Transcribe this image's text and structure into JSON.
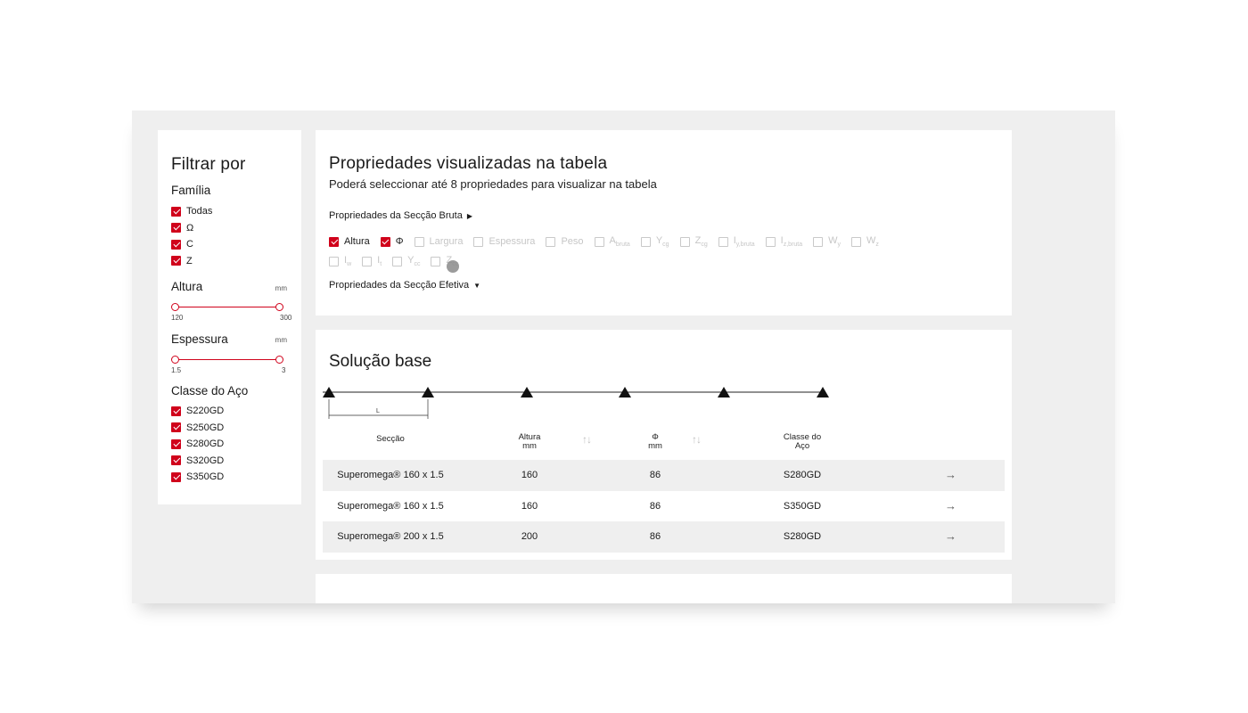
{
  "filter": {
    "title": "Filtrar por",
    "familia": {
      "label": "Família",
      "items": [
        {
          "label": "Todas",
          "checked": true
        },
        {
          "label": "Ω",
          "checked": true
        },
        {
          "label": "C",
          "checked": true
        },
        {
          "label": "Z",
          "checked": true
        }
      ]
    },
    "altura": {
      "label": "Altura",
      "unit": "mm",
      "min": "120",
      "max": "300",
      "range_low_fraction": 0,
      "range_high_fraction": 1
    },
    "espessura": {
      "label": "Espessura",
      "unit": "mm",
      "min": "1.5",
      "max": "3",
      "range_low_fraction": 0,
      "range_high_fraction": 1
    },
    "classe": {
      "label": "Classe do Aço",
      "items": [
        {
          "label": "S220GD",
          "checked": true
        },
        {
          "label": "S250GD",
          "checked": true
        },
        {
          "label": "S280GD",
          "checked": true
        },
        {
          "label": "S320GD",
          "checked": true
        },
        {
          "label": "S350GD",
          "checked": true
        }
      ]
    }
  },
  "props": {
    "title": "Propriedades visualizadas na tabela",
    "subtitle": "Poderá seleccionar até 8 propriedades para visualizar na tabela",
    "bruta_label": "Propriedades da Secção Bruta",
    "bruta_arrow": "▶",
    "efetiva_label": "Propriedades da Secção Efetiva",
    "efetiva_arrow": "▼",
    "row1": [
      {
        "label": "Altura",
        "sub": "",
        "checked": true
      },
      {
        "label": "Φ",
        "sub": "",
        "checked": true
      },
      {
        "label": "Largura",
        "sub": "",
        "checked": false
      },
      {
        "label": "Espessura",
        "sub": "",
        "checked": false
      },
      {
        "label": "Peso",
        "sub": "",
        "checked": false
      },
      {
        "label": "A",
        "sub": "bruta",
        "checked": false
      },
      {
        "label": "Y",
        "sub": "cg",
        "checked": false
      },
      {
        "label": "Z",
        "sub": "cg",
        "checked": false
      },
      {
        "label": "I",
        "sub": "y,bruta",
        "checked": false
      },
      {
        "label": "I",
        "sub": "z,bruta",
        "checked": false
      },
      {
        "label": "W",
        "sub": "y",
        "checked": false
      },
      {
        "label": "W",
        "sub": "z",
        "checked": false
      }
    ],
    "row2": [
      {
        "label": "I",
        "sub": "w",
        "checked": false
      },
      {
        "label": "I",
        "sub": "t",
        "checked": false
      },
      {
        "label": "Y",
        "sub": "cc",
        "checked": false
      },
      {
        "label": "Z",
        "sub": "cc",
        "checked": false
      }
    ]
  },
  "solution": {
    "title": "Solução base",
    "span_label": "L",
    "headers": {
      "seccao": "Secção",
      "altura": "Altura",
      "altura_unit": "mm",
      "phi": "Φ",
      "phi_unit": "mm",
      "classe_line1": "Classe do",
      "classe_line2": "Aço",
      "sort_icon": "↑↓"
    },
    "rows": [
      {
        "seccao": "Superomega® 160 x 1.5",
        "altura": "160",
        "phi": "86",
        "classe": "S280GD",
        "arrow": "→"
      },
      {
        "seccao": "Superomega® 160 x 1.5",
        "altura": "160",
        "phi": "86",
        "classe": "S350GD",
        "arrow": "→"
      },
      {
        "seccao": "Superomega® 200 x 1.5",
        "altura": "200",
        "phi": "86",
        "classe": "S280GD",
        "arrow": "→"
      }
    ]
  },
  "colors": {
    "accent": "#d0021b",
    "frame_bg": "#efefef",
    "panel_bg": "#ffffff",
    "row_alt": "#efefef"
  }
}
